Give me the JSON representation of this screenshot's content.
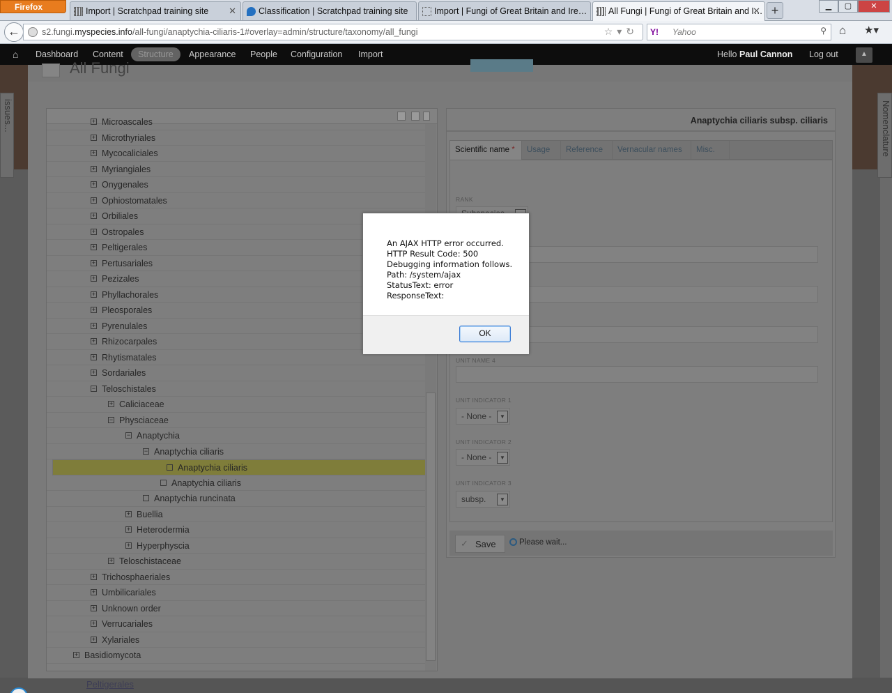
{
  "browser": {
    "menu_label": "Firefox",
    "tabs": [
      {
        "title": "Import | Scratchpad training site",
        "icon": "grid-icon"
      },
      {
        "title": "Classification | Scratchpad training site",
        "icon": "drupal-icon"
      },
      {
        "title": "Import | Fungi of Great Britain and Ire…",
        "icon": "blank-page-icon"
      },
      {
        "title": "All Fungi | Fungi of Great Britain and I…",
        "icon": "grid-icon"
      }
    ],
    "url_prefix": "s2.fungi.",
    "url_domain": "myspecies.info",
    "url_path": "/all-fungi/anaptychia-ciliaris-1#overlay=admin/structure/taxonomy/all_fungi",
    "search_engine_badge": "Y!",
    "search_placeholder": "Yahoo"
  },
  "admin_menu": {
    "items": [
      "Dashboard",
      "Content",
      "Structure",
      "Appearance",
      "People",
      "Configuration",
      "Import"
    ],
    "active": "Structure",
    "hello_prefix": "Hello",
    "user": "Paul Cannon",
    "logout": "Log out"
  },
  "overlay": {
    "page_title": "All Fungi",
    "side_left_label": "issues...",
    "side_right_label": "Nomenclature"
  },
  "tree": {
    "rows": [
      {
        "label": "Microascales",
        "level": 0,
        "state": "collapsed"
      },
      {
        "label": "Microthyriales",
        "level": 0,
        "state": "collapsed"
      },
      {
        "label": "Mycocaliciales",
        "level": 0,
        "state": "collapsed"
      },
      {
        "label": "Myriangiales",
        "level": 0,
        "state": "collapsed"
      },
      {
        "label": "Onygenales",
        "level": 0,
        "state": "collapsed"
      },
      {
        "label": "Ophiostomatales",
        "level": 0,
        "state": "collapsed"
      },
      {
        "label": "Orbiliales",
        "level": 0,
        "state": "collapsed"
      },
      {
        "label": "Ostropales",
        "level": 0,
        "state": "collapsed"
      },
      {
        "label": "Peltigerales",
        "level": 0,
        "state": "collapsed"
      },
      {
        "label": "Pertusariales",
        "level": 0,
        "state": "collapsed"
      },
      {
        "label": "Pezizales",
        "level": 0,
        "state": "collapsed"
      },
      {
        "label": "Phyllachorales",
        "level": 0,
        "state": "collapsed"
      },
      {
        "label": "Pleosporales",
        "level": 0,
        "state": "collapsed"
      },
      {
        "label": "Pyrenulales",
        "level": 0,
        "state": "collapsed"
      },
      {
        "label": "Rhizocarpales",
        "level": 0,
        "state": "collapsed"
      },
      {
        "label": "Rhytismatales",
        "level": 0,
        "state": "collapsed"
      },
      {
        "label": "Sordariales",
        "level": 0,
        "state": "collapsed"
      },
      {
        "label": "Teloschistales",
        "level": 0,
        "state": "expanded"
      },
      {
        "label": "Caliciaceae",
        "level": 1,
        "state": "collapsed"
      },
      {
        "label": "Physciaceae",
        "level": 1,
        "state": "expanded"
      },
      {
        "label": "Anaptychia",
        "level": 2,
        "state": "expanded"
      },
      {
        "label": "Anaptychia ciliaris",
        "level": 3,
        "state": "expanded"
      },
      {
        "label": "Anaptychia ciliaris",
        "level": 4,
        "state": "leaf",
        "selected": true
      },
      {
        "label": "Anaptychia ciliaris",
        "level": 4,
        "state": "leaf"
      },
      {
        "label": "Anaptychia runcinata",
        "level": 3,
        "state": "leaf"
      },
      {
        "label": "Buellia",
        "level": 2,
        "state": "collapsed"
      },
      {
        "label": "Heterodermia",
        "level": 2,
        "state": "collapsed"
      },
      {
        "label": "Hyperphyscia",
        "level": 2,
        "state": "collapsed"
      },
      {
        "label": "Teloschistaceae",
        "level": 1,
        "state": "collapsed"
      },
      {
        "label": "Trichosphaeriales",
        "level": 0,
        "state": "collapsed"
      },
      {
        "label": "Umbilicariales",
        "level": 0,
        "state": "collapsed"
      },
      {
        "label": "Unknown order",
        "level": 0,
        "state": "collapsed"
      },
      {
        "label": "Verrucariales",
        "level": 0,
        "state": "collapsed"
      },
      {
        "label": "Xylariales",
        "level": 0,
        "state": "collapsed"
      },
      {
        "label": "Basidiomycota",
        "level": -1,
        "state": "collapsed"
      }
    ]
  },
  "form": {
    "title": "Anaptychia ciliaris subsp. ciliaris",
    "tabs": [
      "Scientific name",
      "Usage",
      "Reference",
      "Vernacular names",
      "Misc."
    ],
    "required_marker": "*",
    "rank_label": "RANK",
    "rank_value": "Subspecies",
    "unit_name_4_label": "UNIT NAME 4",
    "unit_indicator_1_label": "UNIT INDICATOR 1",
    "unit_indicator_1_value": "- None -",
    "unit_indicator_2_label": "UNIT INDICATOR 2",
    "unit_indicator_2_value": "- None -",
    "unit_indicator_3_label": "UNIT INDICATOR 3",
    "unit_indicator_3_value": "subsp.",
    "save_label": "Save",
    "wait_text": "Please wait..."
  },
  "dialog": {
    "lines": [
      "An AJAX HTTP error occurred.",
      "HTTP Result Code: 500",
      "Debugging information follows.",
      "Path: /system/ajax",
      "StatusText: error",
      "ResponseText:"
    ],
    "ok_label": "OK"
  },
  "background": {
    "bottom_link": "Peltigerales"
  }
}
